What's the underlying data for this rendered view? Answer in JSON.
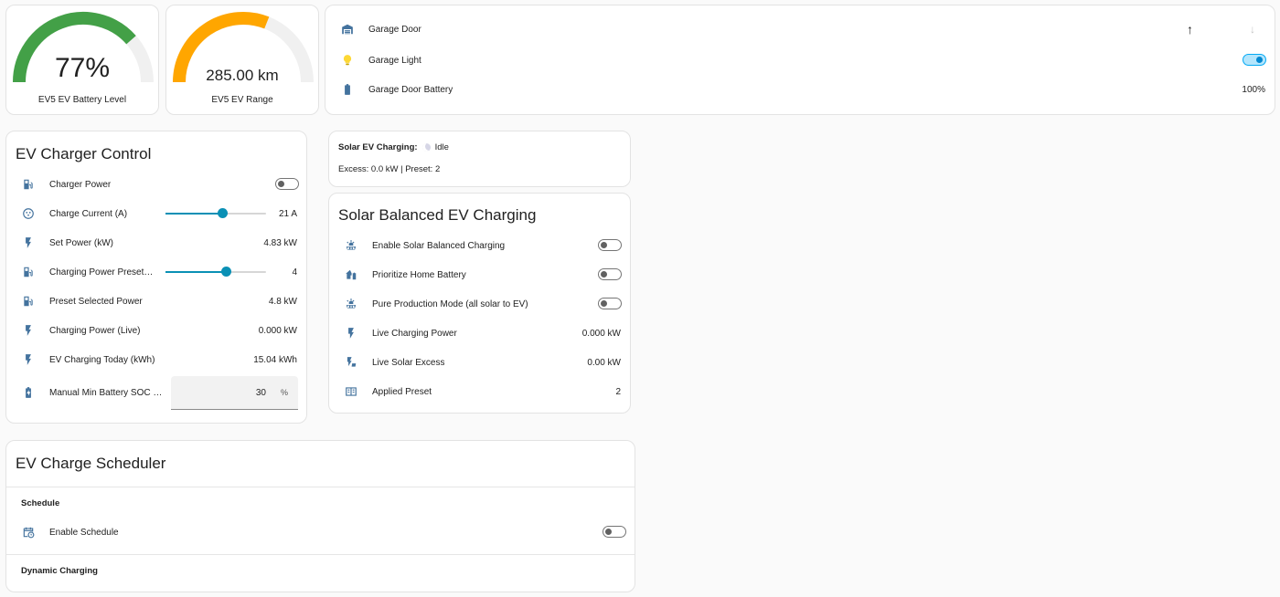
{
  "gauges": [
    {
      "value_text": "77%",
      "name": "EV5 EV Battery Level",
      "fraction": 0.77,
      "color": "#43a047"
    },
    {
      "value_text": "285.00 km",
      "name": "EV5 EV Range",
      "fraction": 0.62,
      "color": "#ffa600"
    }
  ],
  "garage": {
    "rows": [
      {
        "label": "Garage Door",
        "icon": "garage-icon"
      },
      {
        "label": "Garage Light",
        "icon": "lightbulb-icon",
        "toggle_on": true
      },
      {
        "label": "Garage Door Battery",
        "icon": "battery-icon",
        "value": "100%"
      }
    ]
  },
  "charger": {
    "title": "EV Charger Control",
    "rows": [
      {
        "label": "Charger Power",
        "icon": "ev-station-icon",
        "toggle_on": false
      },
      {
        "label": "Charge Current (A)",
        "icon": "current-icon",
        "value": "21 A",
        "slider_fraction": 0.57
      },
      {
        "label": "Set Power (kW)",
        "icon": "flash-icon",
        "value": "4.83 kW"
      },
      {
        "label": "Charging Power Preset (k…",
        "icon": "ev-station-icon",
        "value": "4",
        "slider_fraction": 0.6
      },
      {
        "label": "Preset Selected Power",
        "icon": "ev-station-icon",
        "value": "4.8 kW"
      },
      {
        "label": "Charging Power (Live)",
        "icon": "flash-icon",
        "value": "0.000 kW"
      },
      {
        "label": "EV Charging Today (kWh)",
        "icon": "flash-icon",
        "value": "15.04 kWh"
      },
      {
        "label": "Manual Min Battery SOC Cut…",
        "icon": "battery-charging-icon",
        "input_value": "30",
        "unit": "%"
      }
    ]
  },
  "solar_status": {
    "label": "Solar EV Charging:",
    "state": "Idle",
    "detail": "Excess: 0.0 kW | Preset: 2"
  },
  "solar_balanced": {
    "title": "Solar Balanced EV Charging",
    "rows": [
      {
        "label": "Enable Solar Balanced Charging",
        "icon": "solar-panel-icon",
        "toggle_on": false
      },
      {
        "label": "Prioritize Home Battery",
        "icon": "home-battery-icon",
        "toggle_on": false
      },
      {
        "label": "Pure Production Mode (all solar to EV)",
        "icon": "solar-panel-icon",
        "toggle_on": false
      },
      {
        "label": "Live Charging Power",
        "icon": "flash-icon",
        "value": "0.000 kW"
      },
      {
        "label": "Live Solar Excess",
        "icon": "solar-power-icon",
        "value": "0.00 kW"
      },
      {
        "label": "Applied Preset",
        "icon": "preset-icon",
        "value": "2"
      }
    ]
  },
  "scheduler": {
    "title": "EV Charge Scheduler",
    "section1": "Schedule",
    "enable_label": "Enable Schedule",
    "enable_on": false,
    "section2": "Dynamic Charging"
  },
  "colors": {
    "icon": "#44739e",
    "accent": "#0a90b5",
    "bulb": "#fdd835"
  }
}
